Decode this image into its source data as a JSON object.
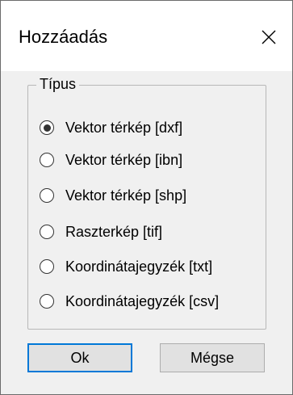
{
  "dialog": {
    "title": "Hozzáadás",
    "close_icon": "close-icon"
  },
  "group": {
    "label": "Típus",
    "options": [
      {
        "label": "Vektor térkép [dxf]",
        "selected": true
      },
      {
        "label": "Vektor térkép [ibn]",
        "selected": false
      },
      {
        "label": "Vektor térkép [shp]",
        "selected": false
      },
      {
        "label": "Raszterkép [tif]",
        "selected": false
      },
      {
        "label": "Koordinátajegyzék [txt]",
        "selected": false
      },
      {
        "label": "Koordinátajegyzék [csv]",
        "selected": false
      }
    ]
  },
  "buttons": {
    "ok_label": "Ok",
    "cancel_label": "Mégse"
  },
  "colors": {
    "focus_border": "#0078d7",
    "dialog_bg": "#f0f0f0",
    "titlebar_bg": "#ffffff"
  }
}
